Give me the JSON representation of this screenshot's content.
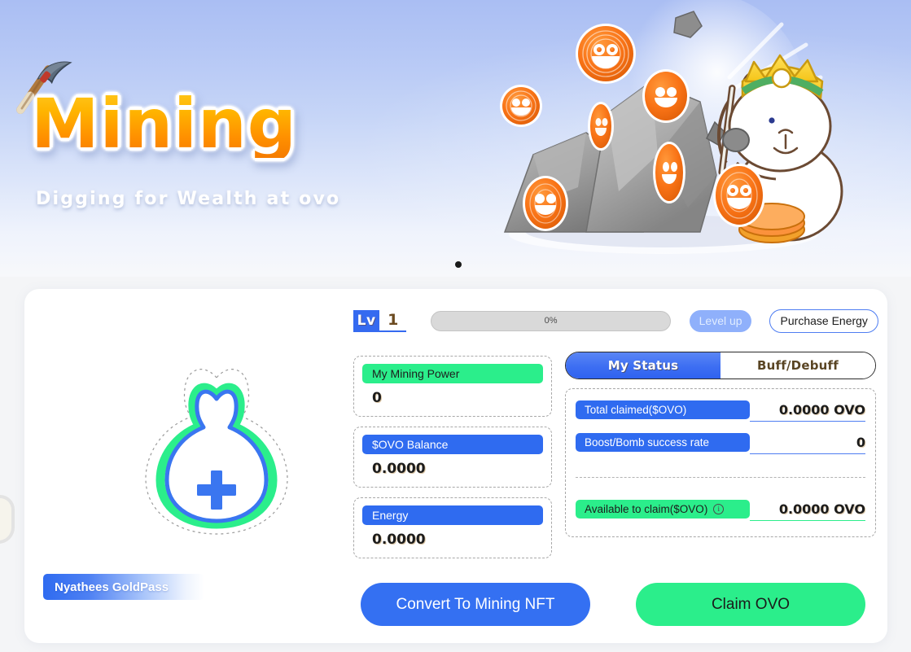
{
  "banner": {
    "title": "Mining",
    "subtitle": "Digging for Wealth at ovo",
    "pickaxe_icon": "pickaxe-icon",
    "art_alt": "cat-miner-with-rocks-and-ovo-coins",
    "carousel_dot": "•"
  },
  "level": {
    "lv_label": "Lv",
    "lv_value": "1",
    "progress_label": "0%",
    "progress_percent": 0,
    "level_up_button": "Level up",
    "purchase_energy_button": "Purchase Energy"
  },
  "nft": {
    "add_icon": "plus-icon",
    "pass_label": "Nyathees GoldPass"
  },
  "stats": [
    {
      "label": "My Mining Power",
      "value": "0",
      "pill_color": "#2bee8b",
      "pill_style": "green"
    },
    {
      "label": "$OVO Balance",
      "value": "0.0000",
      "pill_color": "#2f6bf0",
      "pill_style": "blue"
    },
    {
      "label": "Energy",
      "value": "0.0000",
      "pill_color": "#2f6bf0",
      "pill_style": "blue"
    }
  ],
  "status": {
    "tabs": [
      {
        "label": "My Status",
        "active": true
      },
      {
        "label": "Buff/Debuff",
        "active": false
      }
    ],
    "rows": [
      {
        "label": "Total claimed($OVO)",
        "value": "0.0000 OVO",
        "pill_style": "blue"
      },
      {
        "label": "Boost/Bomb success rate",
        "value": "0",
        "pill_style": "blue"
      }
    ],
    "available": {
      "label": "Available to claim($OVO)",
      "info_icon": "info-icon",
      "info_glyph": "i",
      "value": "0.0000 OVO",
      "pill_style": "green"
    }
  },
  "actions": {
    "convert_button": "Convert To Mining NFT",
    "claim_button": "Claim OVO"
  },
  "colors": {
    "brand_blue": "#2f6bf0",
    "brand_green": "#2bee8b",
    "title_orange": "#ff9000",
    "page_bg": "#f4f5f7",
    "card_bg": "#ffffff"
  }
}
